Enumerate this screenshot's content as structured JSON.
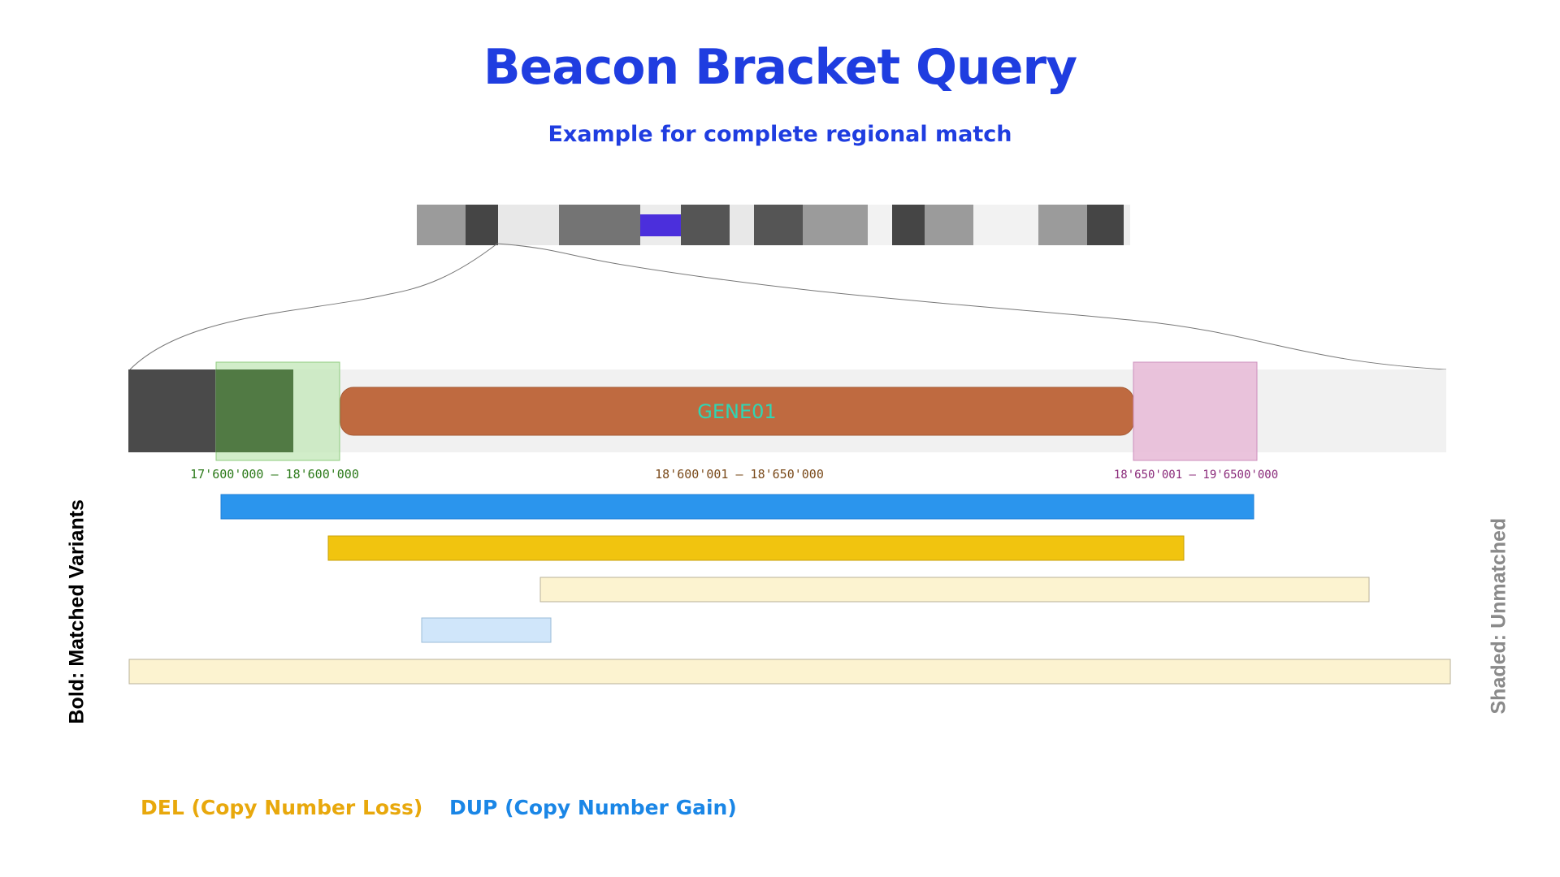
{
  "header": {
    "title": "Beacon Bracket Query",
    "subtitle": "Example for complete regional match",
    "color": "#1f3de0"
  },
  "chromosome": {
    "bands": [
      {
        "shade": "#9b9b9b"
      },
      {
        "shade": "#454545"
      },
      {
        "shade": "#e8e8e8"
      },
      {
        "shade": "#747474"
      },
      {
        "shade": "#4b2fdc",
        "role": "centromere"
      },
      {
        "shade": "#555555"
      },
      {
        "shade": "#e8e8e8"
      },
      {
        "shade": "#555555"
      },
      {
        "shade": "#9b9b9b"
      },
      {
        "shade": "#f2f2f2"
      },
      {
        "shade": "#454545"
      },
      {
        "shade": "#9b9b9b"
      },
      {
        "shade": "#f2f2f2"
      },
      {
        "shade": "#9b9b9b"
      },
      {
        "shade": "#454545"
      }
    ]
  },
  "gene": {
    "label": "GENE01",
    "fill": "#bf6a40",
    "text_color": "#2fd6b4"
  },
  "ranges": [
    {
      "label": "17'600'000 – 18'600'000",
      "color": "#2c7a1a",
      "box_fill": "#c6e8bc",
      "box_stroke": "#8fcc7f"
    },
    {
      "label": "18'600'001 – 18'650'000",
      "color": "#7a4a1a"
    },
    {
      "label": "18'650'001 – 19'6500'000",
      "color": "#8a2a7a",
      "box_fill": "#e8bcd8",
      "box_stroke": "#cc8fbc"
    }
  ],
  "variants": [
    {
      "type": "DUP",
      "matched": true,
      "color": "#2b95ed"
    },
    {
      "type": "DEL",
      "matched": true,
      "color": "#f1c40f"
    },
    {
      "type": "DEL",
      "matched": false,
      "color": "#fcf3d0"
    },
    {
      "type": "DUP",
      "matched": false,
      "color": "#d0e6fa"
    },
    {
      "type": "DEL",
      "matched": false,
      "color": "#fcf3d0"
    }
  ],
  "side_labels": {
    "matched": "Bold: Matched Variants",
    "unmatched": "Shaded: Unmatched"
  },
  "legend": {
    "del_label": "DEL (Copy Number Loss)",
    "del_color": "#e8a80c",
    "dup_label": "DUP (Copy Number Gain)",
    "dup_color": "#1a86e6"
  }
}
